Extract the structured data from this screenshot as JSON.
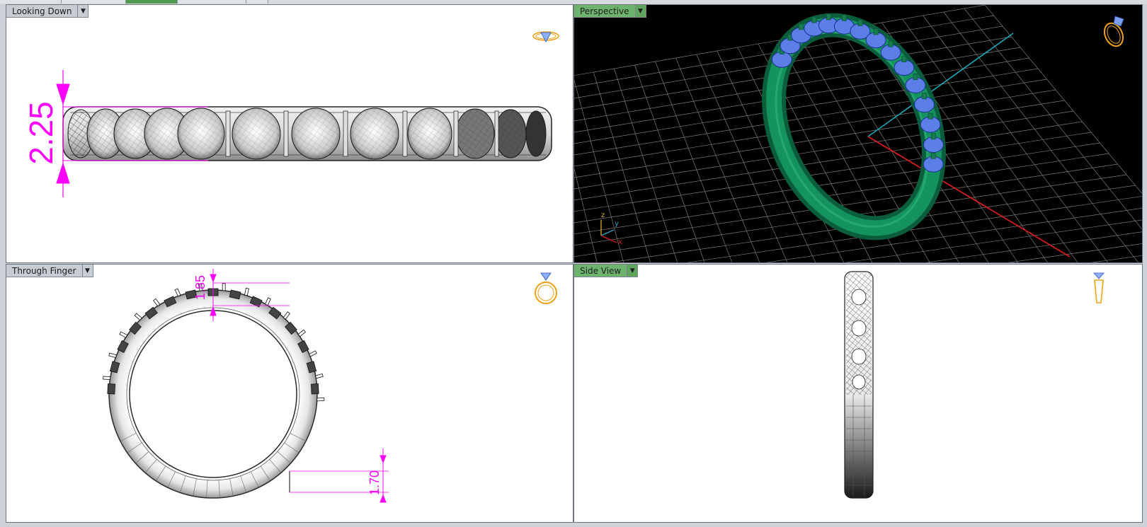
{
  "viewports": {
    "top_left": {
      "label": "Looking Down",
      "dimension": "2.25"
    },
    "top_right": {
      "label": "Perspective",
      "axes": {
        "z": "z",
        "y": "y",
        "x": "x"
      }
    },
    "bottom_left": {
      "label": "Through Finger",
      "dimension_top": "1.85",
      "dimension_bottom": "1.70"
    },
    "bottom_right": {
      "label": "Side View"
    }
  },
  "colors": {
    "dimension": "#ff00ff",
    "active_label": "#6db36d",
    "ring_green": "#0f7a4f",
    "gem_blue": "#5b7fe6",
    "nav_icon": "#f0a21a"
  },
  "icons": {
    "dropdown": "chevron-down-icon",
    "nav": "ring-navigation-icon"
  }
}
